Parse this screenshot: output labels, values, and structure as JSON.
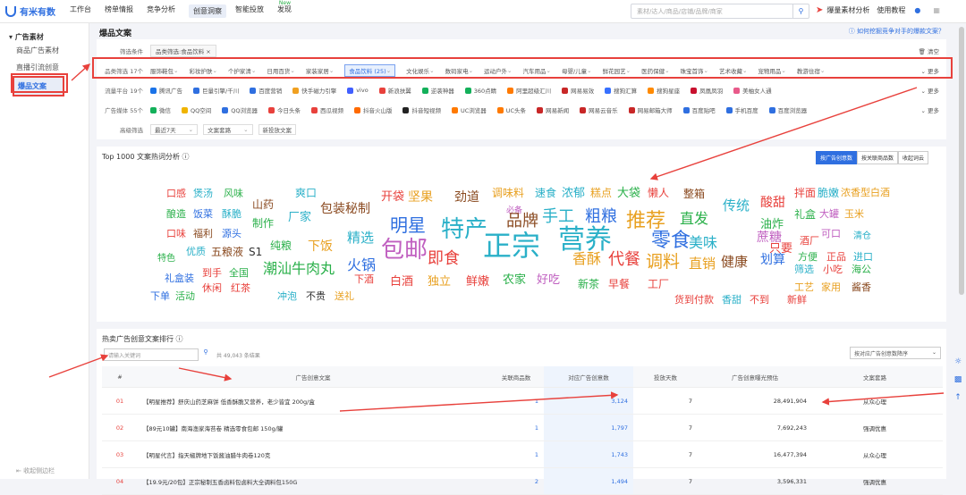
{
  "topbar": {
    "logo": "有米有数",
    "nav": [
      {
        "label": "工作台",
        "active": false,
        "badge": ""
      },
      {
        "label": "榜单情报",
        "active": false,
        "badge": ""
      },
      {
        "label": "竞争分析",
        "active": false,
        "badge": ""
      },
      {
        "label": "创意洞察",
        "active": true,
        "badge": ""
      },
      {
        "label": "智能投放",
        "active": false,
        "badge": ""
      },
      {
        "label": "发现",
        "active": false,
        "badge": "New"
      }
    ],
    "search_placeholder": "素材/达人/商品/店铺/品牌/商家",
    "promo": "爆量素材分析",
    "tutorial": "使用教程"
  },
  "sidebar": {
    "group": "广告素材",
    "items": [
      {
        "label": "商品广告素材",
        "active": false
      },
      {
        "label": "直播引流创意",
        "active": false
      },
      {
        "label": "爆品文案",
        "active": true
      }
    ],
    "collapse": "收起侧边栏"
  },
  "page": {
    "title": "爆品文案",
    "help": "如何挖掘竞争对手的爆款文案？"
  },
  "filters": {
    "cond_label": "筛选条件",
    "cond_tag": "品类筛选:食品饮料 ×",
    "clear": "清空",
    "cat_label": "品类筛选 17个",
    "categories": [
      "服饰鞋包",
      "彩妆护肤",
      "个护家清",
      "日用百货",
      "家装家居",
      "食品饮料 (25)",
      "文化娱乐",
      "数码家电",
      "运动户外",
      "汽车用品",
      "母婴/儿童",
      "鲜花园艺",
      "医药保健",
      "珠宝首饰",
      "艺术收藏",
      "宠物用品",
      "教游住宿"
    ],
    "more": "更多",
    "media_label": "流量平台 19个",
    "media": [
      {
        "name": "腾讯广告",
        "color": "#1a73e8"
      },
      {
        "name": "巨量引擎/千川",
        "color": "#2f6fe0"
      },
      {
        "name": "百度营销",
        "color": "#2f6fe0"
      },
      {
        "name": "快手磁力引擎",
        "color": "#f0a020"
      },
      {
        "name": "vivo",
        "color": "#415fff"
      },
      {
        "name": "新浪扶翼",
        "color": "#e8413c"
      },
      {
        "name": "逆袭神器",
        "color": "#13b05a"
      },
      {
        "name": "360点睛",
        "color": "#13b05a"
      },
      {
        "name": "阿里超级汇川",
        "color": "#ff7a00"
      },
      {
        "name": "网易易效",
        "color": "#c82727"
      },
      {
        "name": "搜狗汇算",
        "color": "#3770ff"
      },
      {
        "name": "搜狗星座",
        "color": "#ff8a00"
      },
      {
        "name": "凤凰凤羽",
        "color": "#c8102e"
      },
      {
        "name": "美柚女人通",
        "color": "#e85a8a"
      }
    ],
    "adv_label": "广告媒体 55个",
    "adv": [
      {
        "name": "微信",
        "color": "#13b05a"
      },
      {
        "name": "QQ空间",
        "color": "#f0b400"
      },
      {
        "name": "QQ浏览器",
        "color": "#2f6fe0"
      },
      {
        "name": "今日头条",
        "color": "#e8413c"
      },
      {
        "name": "西瓜视频",
        "color": "#e8413c"
      },
      {
        "name": "抖音火山版",
        "color": "#ff6a00"
      },
      {
        "name": "抖音短视频",
        "color": "#222"
      },
      {
        "name": "UC浏览器",
        "color": "#ff7a00"
      },
      {
        "name": "UC头条",
        "color": "#ff7a00"
      },
      {
        "name": "网易新闻",
        "color": "#c82727"
      },
      {
        "name": "网易云音乐",
        "color": "#c82727"
      },
      {
        "name": "网易邮箱大师",
        "color": "#c82727"
      },
      {
        "name": "百度贴吧",
        "color": "#2f6fe0"
      },
      {
        "name": "手机百度",
        "color": "#2f6fe0"
      },
      {
        "name": "百度浏览器",
        "color": "#2f6fe0"
      }
    ],
    "adv2_label": "高级筛选",
    "adv2": [
      "最近7天",
      "文案套路",
      "新投放文案"
    ]
  },
  "wordcloud": {
    "title": "Top 1000 文案热词分析",
    "seg": [
      "按广告创意数",
      "按关联商品数",
      "收起词云"
    ],
    "words": [
      {
        "t": "口感",
        "c": "#e8413c",
        "s": 11
      },
      {
        "t": "煲汤",
        "c": "#2ab0c8",
        "s": 11
      },
      {
        "t": "风味",
        "c": "#2ab04a",
        "s": 11
      },
      {
        "t": "酿造",
        "c": "#2ab04a",
        "s": 11
      },
      {
        "t": "饭菜",
        "c": "#2f6fe0",
        "s": 11
      },
      {
        "t": "酥脆",
        "c": "#2ab0c8",
        "s": 11
      },
      {
        "t": "口味",
        "c": "#e8413c",
        "s": 11
      },
      {
        "t": "福利",
        "c": "#8a4a20",
        "s": 11
      },
      {
        "t": "源头",
        "c": "#2f6fe0",
        "s": 11
      },
      {
        "t": "特色",
        "c": "#2ab04a",
        "s": 10
      },
      {
        "t": "优质",
        "c": "#2ab0c8",
        "s": 11
      },
      {
        "t": "五粮液",
        "c": "#8a4a20",
        "s": 12
      },
      {
        "t": "S1",
        "c": "#333",
        "s": 12
      },
      {
        "t": "礼盒装",
        "c": "#2f6fe0",
        "s": 11
      },
      {
        "t": "到手",
        "c": "#e8413c",
        "s": 11
      },
      {
        "t": "全国",
        "c": "#2ab04a",
        "s": 11
      },
      {
        "t": "下单",
        "c": "#2f6fe0",
        "s": 11
      },
      {
        "t": "活动",
        "c": "#2ab04a",
        "s": 11
      },
      {
        "t": "休闲",
        "c": "#e8413c",
        "s": 11
      },
      {
        "t": "红茶",
        "c": "#e8413c",
        "s": 11
      },
      {
        "t": "山药",
        "c": "#8a4a20",
        "s": 12
      },
      {
        "t": "制作",
        "c": "#2ab04a",
        "s": 12
      },
      {
        "t": "爽口",
        "c": "#2ab0c8",
        "s": 12
      },
      {
        "t": "厂家",
        "c": "#2ab0c8",
        "s": 13
      },
      {
        "t": "包装秘制",
        "c": "#8a4a20",
        "s": 14
      },
      {
        "t": "纯粮",
        "c": "#2ab04a",
        "s": 12
      },
      {
        "t": "下饭",
        "c": "#e8a020",
        "s": 14
      },
      {
        "t": "精选",
        "c": "#2ab0c8",
        "s": 15
      },
      {
        "t": "潮汕牛肉丸",
        "c": "#2ab04a",
        "s": 16
      },
      {
        "t": "火锅",
        "c": "#2f6fe0",
        "s": 16
      },
      {
        "t": "冲泡",
        "c": "#2ab0c8",
        "s": 11
      },
      {
        "t": "不贵",
        "c": "#333",
        "s": 11
      },
      {
        "t": "送礼",
        "c": "#e8a020",
        "s": 11
      },
      {
        "t": "下酒",
        "c": "#e8413c",
        "s": 11
      },
      {
        "t": "开袋",
        "c": "#e8413c",
        "s": 13
      },
      {
        "t": "坚果",
        "c": "#e8a020",
        "s": 14
      },
      {
        "t": "劲道",
        "c": "#8a4a20",
        "s": 14
      },
      {
        "t": "明星",
        "c": "#2f6fe0",
        "s": 20
      },
      {
        "t": "包邮",
        "c": "#c060c0",
        "s": 26
      },
      {
        "t": "特产",
        "c": "#2ab0c8",
        "s": 26
      },
      {
        "t": "即食",
        "c": "#e8413c",
        "s": 18
      },
      {
        "t": "白酒",
        "c": "#e8413c",
        "s": 13
      },
      {
        "t": "独立",
        "c": "#e8a020",
        "s": 13
      },
      {
        "t": "鲜嫩",
        "c": "#e8413c",
        "s": 13
      },
      {
        "t": "调味料",
        "c": "#e8a020",
        "s": 12
      },
      {
        "t": "必备",
        "c": "#c060c0",
        "s": 9
      },
      {
        "t": "品牌",
        "c": "#8a4a20",
        "s": 18
      },
      {
        "t": "正宗",
        "c": "#2ab0c8",
        "s": 32
      },
      {
        "t": "农家",
        "c": "#2ab04a",
        "s": 13
      },
      {
        "t": "好吃",
        "c": "#c060c0",
        "s": 13
      },
      {
        "t": "速食",
        "c": "#2ab0c8",
        "s": 12
      },
      {
        "t": "浓郁",
        "c": "#2ab0c8",
        "s": 13
      },
      {
        "t": "糕点",
        "c": "#e8a020",
        "s": 12
      },
      {
        "t": "大袋",
        "c": "#2ab04a",
        "s": 13
      },
      {
        "t": "手工",
        "c": "#2ab0c8",
        "s": 18
      },
      {
        "t": "粗粮",
        "c": "#2f6fe0",
        "s": 18
      },
      {
        "t": "营养",
        "c": "#2ab0c8",
        "s": 30
      },
      {
        "t": "香酥",
        "c": "#e8a020",
        "s": 16
      },
      {
        "t": "代餐",
        "c": "#e8413c",
        "s": 18
      },
      {
        "t": "新茶",
        "c": "#2ab04a",
        "s": 12
      },
      {
        "t": "早餐",
        "c": "#e8413c",
        "s": 12
      },
      {
        "t": "懒人",
        "c": "#e8413c",
        "s": 12
      },
      {
        "t": "推荐",
        "c": "#e8a020",
        "s": 22
      },
      {
        "t": "零食",
        "c": "#2f6fe0",
        "s": 22
      },
      {
        "t": "调料",
        "c": "#e8a020",
        "s": 19
      },
      {
        "t": "工厂",
        "c": "#e8413c",
        "s": 12
      },
      {
        "t": "整箱",
        "c": "#8a4a20",
        "s": 12
      },
      {
        "t": "直发",
        "c": "#2ab04a",
        "s": 16
      },
      {
        "t": "美味",
        "c": "#2ab0c8",
        "s": 16
      },
      {
        "t": "直销",
        "c": "#e8a020",
        "s": 15
      },
      {
        "t": "健康",
        "c": "#8a4a20",
        "s": 15
      },
      {
        "t": "货到付款",
        "c": "#e8413c",
        "s": 11
      },
      {
        "t": "香甜",
        "c": "#2ab0c8",
        "s": 11
      },
      {
        "t": "不到",
        "c": "#e8413c",
        "s": 11
      },
      {
        "t": "传统",
        "c": "#2ab0c8",
        "s": 15
      },
      {
        "t": "蔗糖",
        "c": "#c060c0",
        "s": 14
      },
      {
        "t": "划算",
        "c": "#2f6fe0",
        "s": 14
      },
      {
        "t": "酸甜",
        "c": "#e8413c",
        "s": 14
      },
      {
        "t": "油炸",
        "c": "#2ab04a",
        "s": 13
      },
      {
        "t": "只要",
        "c": "#e8413c",
        "s": 13
      },
      {
        "t": "拌面",
        "c": "#e8413c",
        "s": 12
      },
      {
        "t": "脆嫩",
        "c": "#2ab0c8",
        "s": 12
      },
      {
        "t": "浓香型白酒",
        "c": "#e8a020",
        "s": 11
      },
      {
        "t": "礼盒",
        "c": "#2ab04a",
        "s": 12
      },
      {
        "t": "大罐",
        "c": "#c060c0",
        "s": 11
      },
      {
        "t": "玉米",
        "c": "#e8a020",
        "s": 11
      },
      {
        "t": "酒厂",
        "c": "#e8413c",
        "s": 11
      },
      {
        "t": "可口",
        "c": "#c060c0",
        "s": 11
      },
      {
        "t": "清仓",
        "c": "#2ab0c8",
        "s": 10
      },
      {
        "t": "方便",
        "c": "#2ab04a",
        "s": 11
      },
      {
        "t": "正品",
        "c": "#e8413c",
        "s": 11
      },
      {
        "t": "进口",
        "c": "#2ab0c8",
        "s": 11
      },
      {
        "t": "筛选",
        "c": "#2ab0c8",
        "s": 11
      },
      {
        "t": "小吃",
        "c": "#e8413c",
        "s": 11
      },
      {
        "t": "海公",
        "c": "#2ab04a",
        "s": 11
      },
      {
        "t": "工艺",
        "c": "#e8a020",
        "s": 11
      },
      {
        "t": "家用",
        "c": "#e8a020",
        "s": 11
      },
      {
        "t": "酱香",
        "c": "#8a4a20",
        "s": 11
      },
      {
        "t": "新鲜",
        "c": "#e8413c",
        "s": 11
      }
    ]
  },
  "ranking": {
    "title": "热卖广告创意文案排行",
    "search_placeholder": "请输入关键词",
    "count": "共 49,043 条结果",
    "sort": "按对应广告创意数降序",
    "columns": [
      "#",
      "广告创意文案",
      "关联商品数",
      "对应广告创意数",
      "投放天数",
      "广告创意曝光预估",
      "文案套路"
    ],
    "rows": [
      {
        "rank": "01",
        "text": "【明星推荐】舒庆山药芝麻饼 低香酥脆又营养，老少皆宜 200g/盒",
        "goods": "1",
        "ads": "3,124",
        "days": "7",
        "exposure": "28,491,904",
        "style": "从众心理"
      },
      {
        "rank": "02",
        "text": "【89元10罐】南海渔家海苔卷 精选零食包邮 150g/罐",
        "goods": "1",
        "ads": "1,797",
        "days": "7",
        "exposure": "7,692,243",
        "style": "强调优惠"
      },
      {
        "rank": "03",
        "text": "【明星代言】指天椒牌地下饭酱油腊牛肉卷120克",
        "goods": "1",
        "ads": "1,743",
        "days": "7",
        "exposure": "16,477,394",
        "style": "从众心理"
      },
      {
        "rank": "04",
        "text": "【19.9元/20包】正宗秘制五香卤料包卤料大全调料包150G",
        "goods": "2",
        "ads": "1,494",
        "days": "7",
        "exposure": "3,596,331",
        "style": "强调优惠"
      }
    ]
  },
  "colors": {
    "accent": "#2f6fe0",
    "annotation": "#e8413c"
  }
}
